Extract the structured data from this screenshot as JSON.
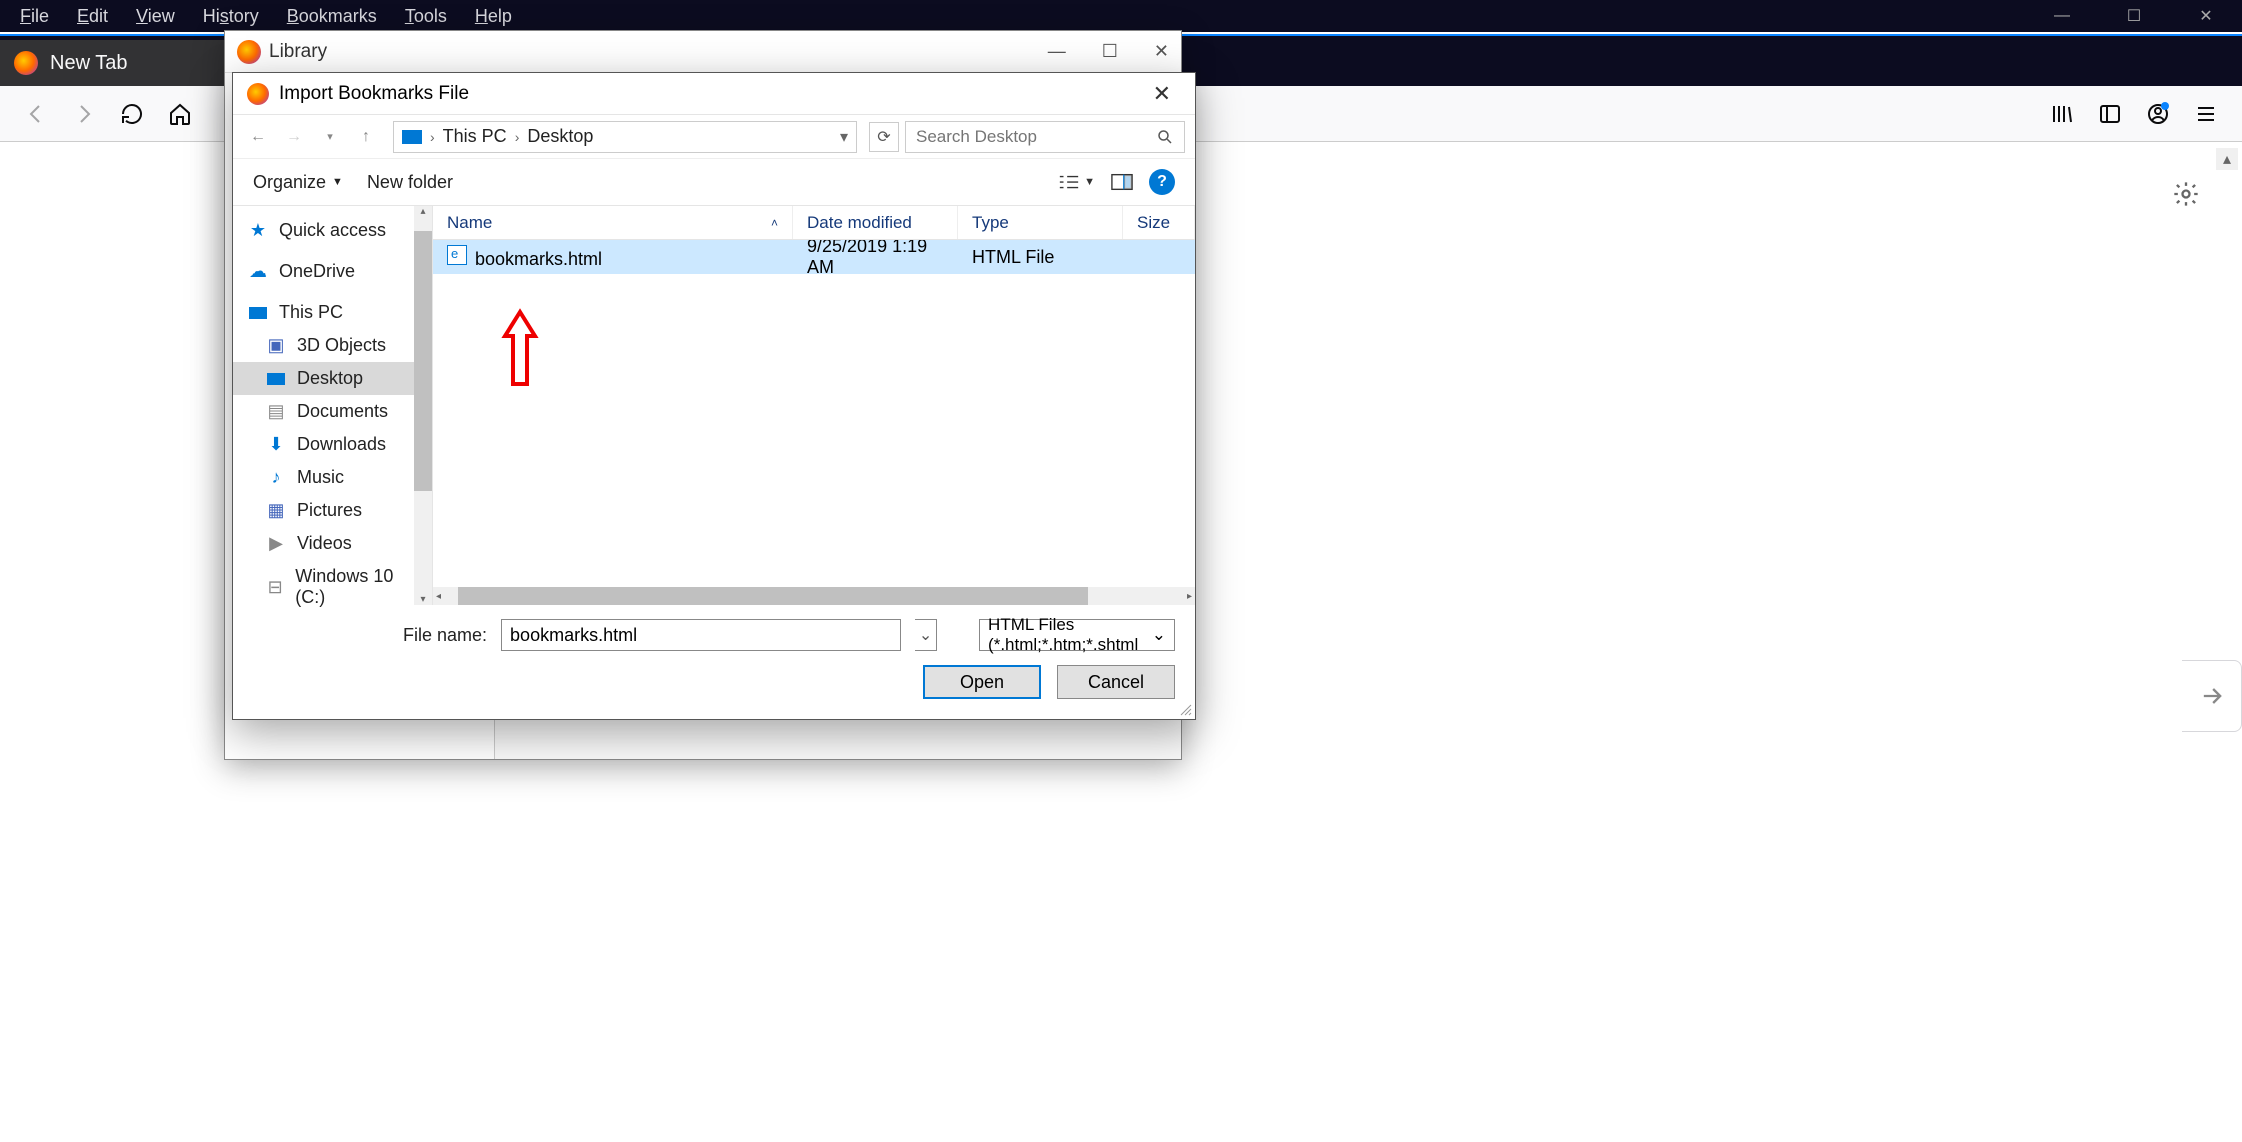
{
  "menubar": {
    "items": [
      "File",
      "Edit",
      "View",
      "History",
      "Bookmarks",
      "Tools",
      "Help"
    ]
  },
  "tab": {
    "title": "New Tab"
  },
  "library": {
    "title": "Library"
  },
  "dialog": {
    "title": "Import Bookmarks File",
    "breadcrumb": {
      "root": "This PC",
      "current": "Desktop"
    },
    "search_placeholder": "Search Desktop",
    "organize": "Organize",
    "new_folder": "New folder",
    "columns": {
      "name": "Name",
      "date": "Date modified",
      "type": "Type",
      "size": "Size"
    },
    "nav": {
      "quick_access": "Quick access",
      "onedrive": "OneDrive",
      "this_pc": "This PC",
      "objects3d": "3D Objects",
      "desktop": "Desktop",
      "documents": "Documents",
      "downloads": "Downloads",
      "music": "Music",
      "pictures": "Pictures",
      "videos": "Videos",
      "drive_c": "Windows 10 (C:)"
    },
    "file": {
      "name": "bookmarks.html",
      "date": "9/25/2019 1:19 AM",
      "type": "HTML File"
    },
    "filename_label": "File name:",
    "filename_value": "bookmarks.html",
    "filetype": "HTML Files (*.html;*.htm;*.shtml",
    "open": "Open",
    "cancel": "Cancel"
  }
}
